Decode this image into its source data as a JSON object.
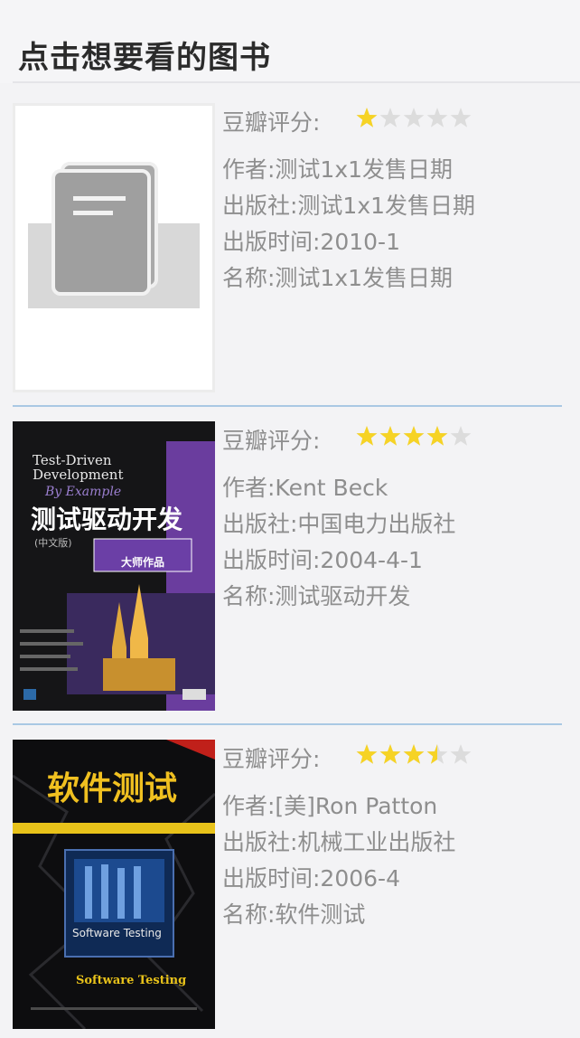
{
  "header": {
    "title": "点击想要看的图书"
  },
  "colors": {
    "star_on": "#f6d325",
    "star_off": "#dcdcdc",
    "divider": "#a9c8e3"
  },
  "books": [
    {
      "rating_label": "豆瓣评分:",
      "rating_stars": 1,
      "author": "作者:测试1x1发售日期",
      "publisher": "出版社:测试1x1发售日期",
      "pub_date": "出版时间:2010-1",
      "name": "名称:测试1x1发售日期",
      "cover": "placeholder-book-icon"
    },
    {
      "rating_label": "豆瓣评分:",
      "rating_stars": 4,
      "author": "作者:Kent Beck",
      "publisher": "出版社:中国电力出版社",
      "pub_date": "出版时间:2004-4-1",
      "name": "名称:测试驱动开发",
      "cover": {
        "title_en_1": "Test-Driven",
        "title_en_2": "Development",
        "title_en_3": "By Example",
        "title_cn": "测试驱动开发",
        "edition": "(中文版)",
        "series": "大师作品"
      }
    },
    {
      "rating_label": "豆瓣评分:",
      "rating_stars": 3.5,
      "author": "作者:[美]Ron Patton",
      "publisher": "出版社:机械工业出版社",
      "pub_date": "出版时间:2006-4",
      "name": "名称:软件测试",
      "cover": {
        "title_cn": "软件测试",
        "title_en": "Software Testing",
        "title_en_bottom": "Software Testing"
      }
    }
  ]
}
